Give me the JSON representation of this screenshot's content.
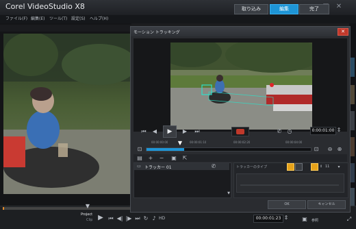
{
  "app": {
    "title": "Corel VideoStudio X8"
  },
  "menu": [
    "ファイル(F)",
    "編集(E)",
    "ツール(T)",
    "設定(S)",
    "ヘルプ(H)"
  ],
  "workspace_tabs": [
    {
      "label": "取り込み",
      "active": false
    },
    {
      "label": "編集",
      "active": true
    },
    {
      "label": "完了",
      "active": false
    }
  ],
  "bottom": {
    "project_label": "Project",
    "clip_label": "Clip",
    "hd_label": "HD",
    "timecode": "00:00:01:23",
    "params_label": "参照"
  },
  "dialog": {
    "title": "モーション トラッキング",
    "timecode": "0:00:01:00",
    "ruler": [
      "00:00:00:00",
      "00:00:01:10",
      "00:00:02:20",
      "00:00:04:00"
    ],
    "tracker_name": "トラッカー 01",
    "tracker_type_label": "トラッカーのタイプ",
    "size_value": "11",
    "ok_label": "OK",
    "cancel_label": "キャンセル"
  },
  "colors": {
    "accent": "#1e95d6",
    "tracker_point": "#e0242a",
    "tracker_box": "#2ee0c8"
  },
  "icons": [
    "minimize-icon",
    "maximize-icon",
    "close-icon",
    "play-icon",
    "prev-icon",
    "next-icon",
    "home-icon",
    "end-icon",
    "record-icon",
    "zoom-out-icon",
    "zoom-in-icon",
    "add-icon",
    "remove-icon",
    "tracker-icon",
    "eye-icon",
    "settings-icon"
  ]
}
